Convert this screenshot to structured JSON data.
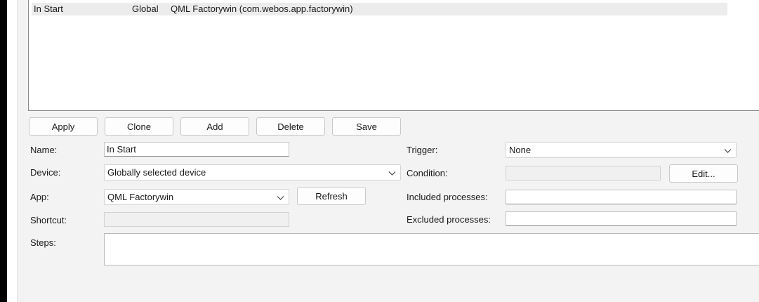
{
  "list": {
    "rows": [
      {
        "name": "In Start",
        "scope": "Global",
        "app": "QML Factorywin (com.webos.app.factorywin)"
      }
    ]
  },
  "toolbar": {
    "apply_label": "Apply",
    "clone_label": "Clone",
    "add_label": "Add",
    "delete_label": "Delete",
    "save_label": "Save"
  },
  "form": {
    "name_label": "Name:",
    "name_value": "In Start",
    "device_label": "Device:",
    "device_value": "Globally selected device",
    "app_label": "App:",
    "app_value": "QML Factorywin",
    "refresh_label": "Refresh",
    "shortcut_label": "Shortcut:",
    "shortcut_value": "",
    "steps_label": "Steps:",
    "trigger_label": "Trigger:",
    "trigger_value": "None",
    "condition_label": "Condition:",
    "condition_value": "",
    "edit_label": "Edit...",
    "included_label": "Included processes:",
    "included_value": "",
    "excluded_label": "Excluded processes:",
    "excluded_value": ""
  },
  "icons": {
    "dropdown": "chevron-down-icon"
  },
  "colors": {
    "selected_row": "#ececec",
    "window_bg": "#f3f3f3",
    "disabled_field": "#f0f0f0"
  }
}
